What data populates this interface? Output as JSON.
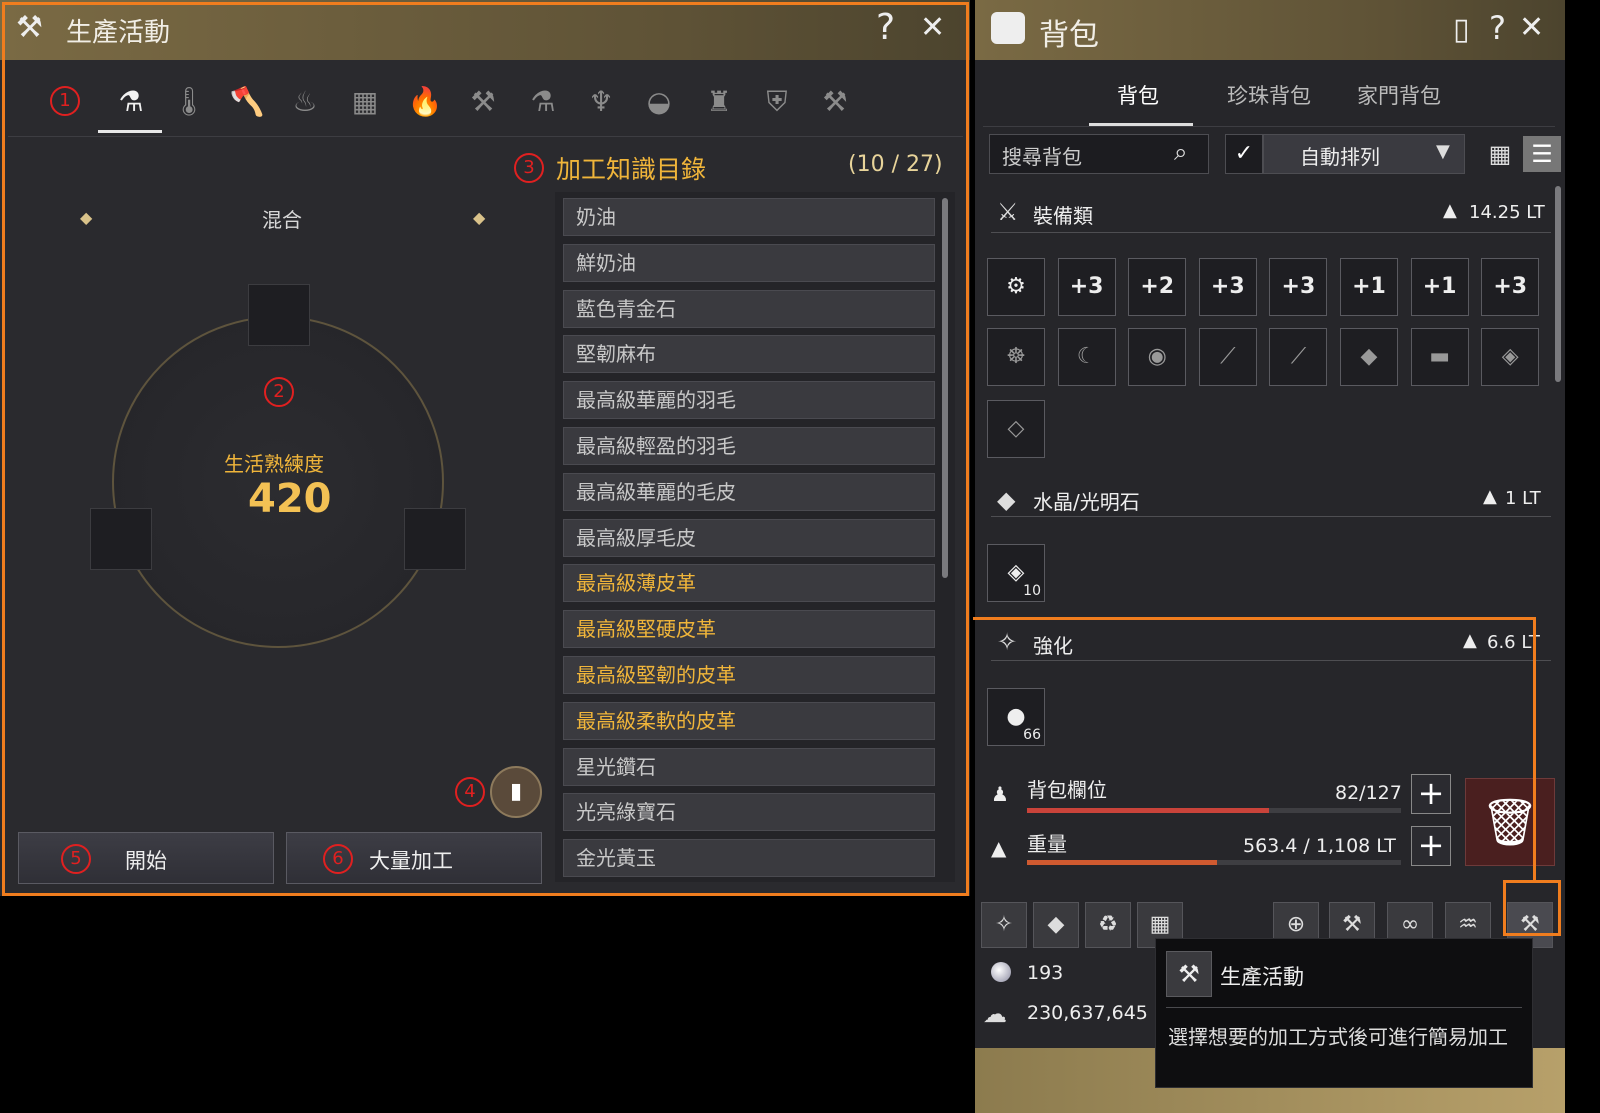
{
  "production": {
    "title": "生產活動",
    "help": "?",
    "close": "✕",
    "catalog_title": "加工知識目錄",
    "catalog_count": "(10 / 27)",
    "mode": "混合",
    "mastery_label": "生活熟練度",
    "mastery_value": "420",
    "markers": {
      "m1": "1",
      "m2": "2",
      "m3": "3",
      "m4": "4",
      "m5": "5",
      "m6": "6"
    },
    "start": "開始",
    "mass": "大量加工",
    "items": [
      {
        "label": "奶油",
        "gold": false
      },
      {
        "label": "鮮奶油",
        "gold": false
      },
      {
        "label": "藍色青金石",
        "gold": false
      },
      {
        "label": "堅韌麻布",
        "gold": false
      },
      {
        "label": "最高級華麗的羽毛",
        "gold": false
      },
      {
        "label": "最高級輕盈的羽毛",
        "gold": false
      },
      {
        "label": "最高級華麗的毛皮",
        "gold": false
      },
      {
        "label": "最高級厚毛皮",
        "gold": false
      },
      {
        "label": "最高級薄皮革",
        "gold": true
      },
      {
        "label": "最高級堅硬皮革",
        "gold": true
      },
      {
        "label": "最高級堅韌的皮革",
        "gold": true
      },
      {
        "label": "最高級柔軟的皮革",
        "gold": true
      },
      {
        "label": "星光鑽石",
        "gold": false
      },
      {
        "label": "光亮綠寶石",
        "gold": false
      },
      {
        "label": "金光黃玉",
        "gold": false
      }
    ]
  },
  "bag": {
    "title": "背包",
    "help": "?",
    "close": "✕",
    "tabs": [
      "背包",
      "珍珠背包",
      "家門背包"
    ],
    "search_placeholder": "搜尋背包",
    "sort": "自動排列",
    "equip": {
      "name": "裝備類",
      "lt": "14.25 LT"
    },
    "crystal": {
      "name": "水晶/光明石",
      "lt": "1 LT"
    },
    "enh": {
      "name": "強化",
      "lt": "6.6 LT"
    },
    "equip_row1": [
      "",
      "+3",
      "+2",
      "+3",
      "+3",
      "+1",
      "+1",
      "+3"
    ],
    "crystal_count": "10",
    "enh_count": "66",
    "slots_label": "背包欄位",
    "slots_value": "82/127",
    "slots_fill": 0.646,
    "weight_label": "重量",
    "weight_value": "563.4 / 1,108 LT",
    "weight_fill": 0.508,
    "pearl": "193",
    "silver": "230,637,645"
  },
  "tooltip": {
    "title": "生產活動",
    "desc": "選擇想要的加工方式後可進行簡易加工"
  },
  "colors": {
    "accent": "#f07d1e",
    "gold": "#f0b53a",
    "marker": "#e02020"
  }
}
